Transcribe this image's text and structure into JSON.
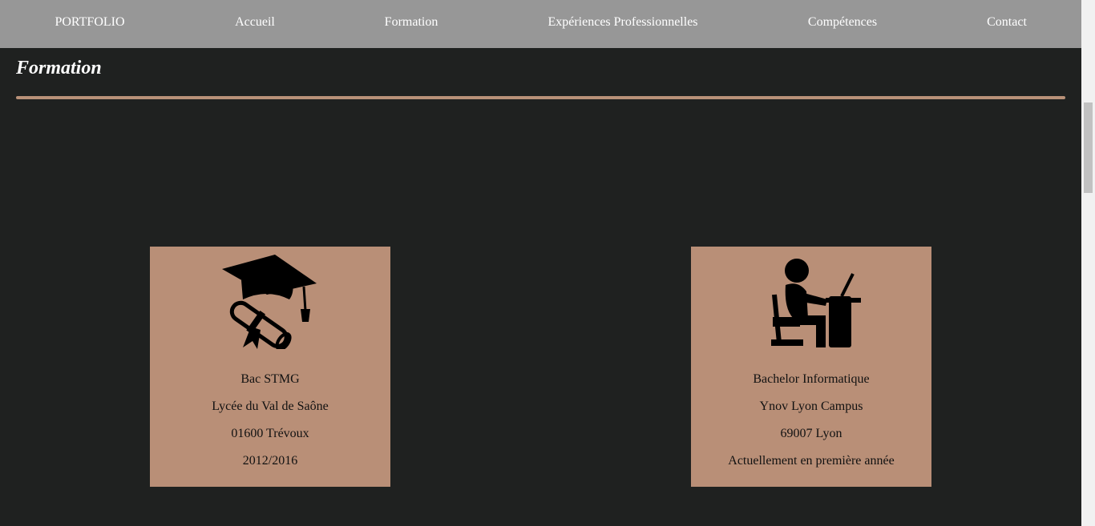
{
  "nav": {
    "items": [
      {
        "label": "PORTFOLIO"
      },
      {
        "label": "Accueil"
      },
      {
        "label": "Formation"
      },
      {
        "label": "Expériences Professionnelles"
      },
      {
        "label": "Compétences"
      },
      {
        "label": "Contact"
      }
    ]
  },
  "section": {
    "title": "Formation"
  },
  "cards": [
    {
      "icon": "graduation-cap-diploma-icon",
      "lines": [
        "Bac STMG",
        "Lycée du Val de Saône",
        "01600 Trévoux",
        "2012/2016"
      ]
    },
    {
      "icon": "student-at-desk-icon",
      "lines": [
        "Bachelor Informatique",
        "Ynov Lyon Campus",
        "69007 Lyon",
        "Actuellement en première année"
      ]
    }
  ],
  "colors": {
    "navbar": "#979797",
    "background": "#1f2120",
    "accent": "#b98f77"
  }
}
